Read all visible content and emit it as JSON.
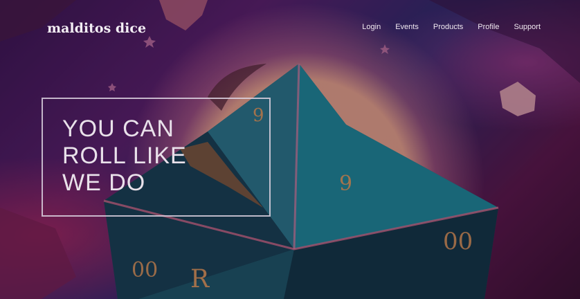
{
  "brand": {
    "logo_text": "malditos dice"
  },
  "nav": {
    "items": [
      {
        "label": "Login"
      },
      {
        "label": "Events"
      },
      {
        "label": "Products"
      },
      {
        "label": "Profile"
      },
      {
        "label": "Support"
      }
    ]
  },
  "hero": {
    "tagline_lines": [
      "YOU CAN",
      "ROLL LIKE",
      "WE DO"
    ],
    "background": {
      "description_colors": [
        "#3a1450",
        "#2b2a6a",
        "#eea68c",
        "#1f8fa0",
        "#5a1648"
      ]
    }
  }
}
